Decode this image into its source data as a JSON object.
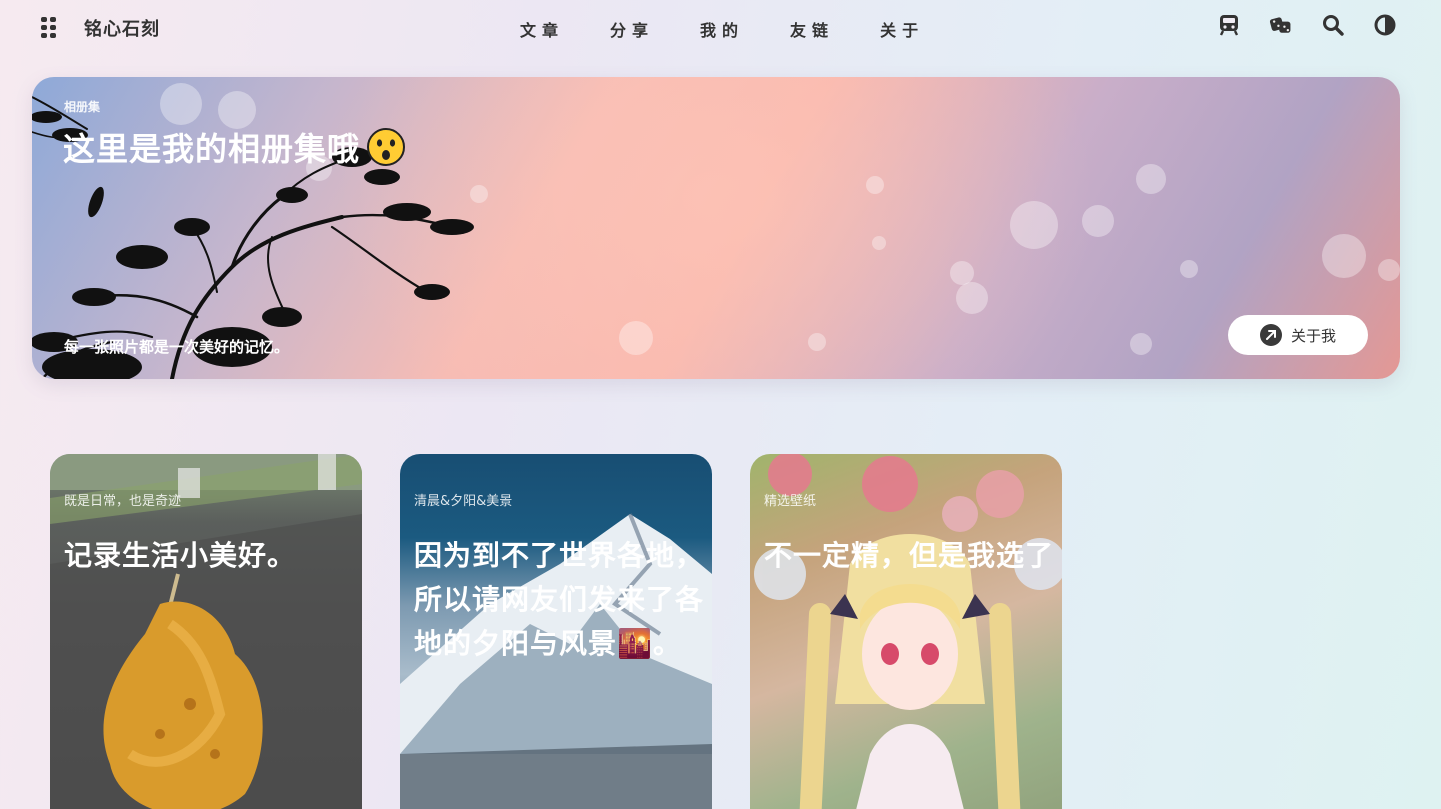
{
  "brand": "铭心石刻",
  "nav": [
    "文章",
    "分享",
    "我的",
    "友链",
    "关于"
  ],
  "nav_icons": [
    "train-icon",
    "dice-icon",
    "search-icon",
    "theme-toggle-icon"
  ],
  "banner": {
    "tag": "相册集",
    "title": "这里是我的相册集哦",
    "title_emoji": "astonished-face-emoji",
    "description": "每一张照片都是一次美好的记忆。",
    "button_label": "关于我"
  },
  "cards": [
    {
      "tag": "既是日常，也是奇迹",
      "title": "记录生活小美好。"
    },
    {
      "tag": "清晨&夕阳&美景",
      "title": "因为到不了世界各地，所以请网友们发来了各地的夕阳与风景🌇。"
    },
    {
      "tag": "精选壁纸",
      "title": "不一定精，但是我选了"
    }
  ],
  "colors": {
    "text": "#333333",
    "accent_button": "#3a3a3a"
  }
}
